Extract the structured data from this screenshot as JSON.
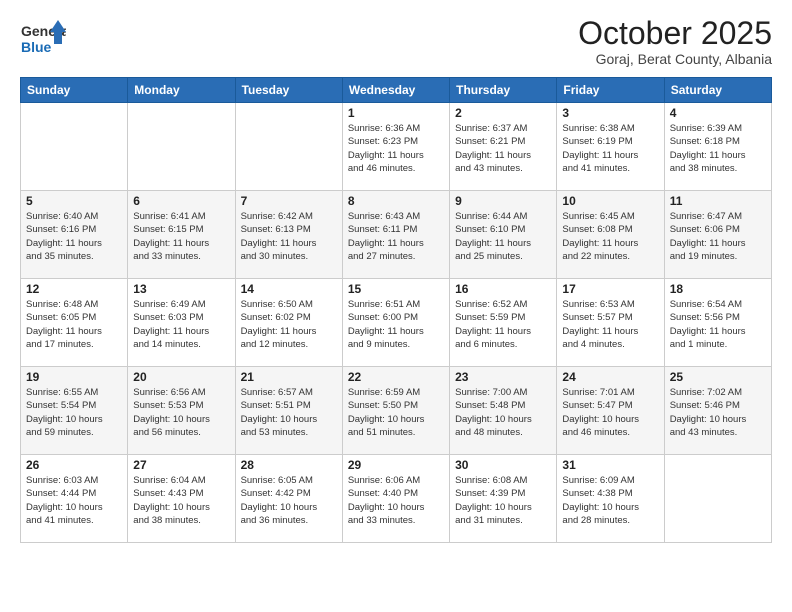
{
  "logo": {
    "general": "General",
    "blue": "Blue"
  },
  "header": {
    "month": "October 2025",
    "location": "Goraj, Berat County, Albania"
  },
  "weekdays": [
    "Sunday",
    "Monday",
    "Tuesday",
    "Wednesday",
    "Thursday",
    "Friday",
    "Saturday"
  ],
  "weeks": [
    [
      {
        "day": "",
        "info": ""
      },
      {
        "day": "",
        "info": ""
      },
      {
        "day": "",
        "info": ""
      },
      {
        "day": "1",
        "info": "Sunrise: 6:36 AM\nSunset: 6:23 PM\nDaylight: 11 hours\nand 46 minutes."
      },
      {
        "day": "2",
        "info": "Sunrise: 6:37 AM\nSunset: 6:21 PM\nDaylight: 11 hours\nand 43 minutes."
      },
      {
        "day": "3",
        "info": "Sunrise: 6:38 AM\nSunset: 6:19 PM\nDaylight: 11 hours\nand 41 minutes."
      },
      {
        "day": "4",
        "info": "Sunrise: 6:39 AM\nSunset: 6:18 PM\nDaylight: 11 hours\nand 38 minutes."
      }
    ],
    [
      {
        "day": "5",
        "info": "Sunrise: 6:40 AM\nSunset: 6:16 PM\nDaylight: 11 hours\nand 35 minutes."
      },
      {
        "day": "6",
        "info": "Sunrise: 6:41 AM\nSunset: 6:15 PM\nDaylight: 11 hours\nand 33 minutes."
      },
      {
        "day": "7",
        "info": "Sunrise: 6:42 AM\nSunset: 6:13 PM\nDaylight: 11 hours\nand 30 minutes."
      },
      {
        "day": "8",
        "info": "Sunrise: 6:43 AM\nSunset: 6:11 PM\nDaylight: 11 hours\nand 27 minutes."
      },
      {
        "day": "9",
        "info": "Sunrise: 6:44 AM\nSunset: 6:10 PM\nDaylight: 11 hours\nand 25 minutes."
      },
      {
        "day": "10",
        "info": "Sunrise: 6:45 AM\nSunset: 6:08 PM\nDaylight: 11 hours\nand 22 minutes."
      },
      {
        "day": "11",
        "info": "Sunrise: 6:47 AM\nSunset: 6:06 PM\nDaylight: 11 hours\nand 19 minutes."
      }
    ],
    [
      {
        "day": "12",
        "info": "Sunrise: 6:48 AM\nSunset: 6:05 PM\nDaylight: 11 hours\nand 17 minutes."
      },
      {
        "day": "13",
        "info": "Sunrise: 6:49 AM\nSunset: 6:03 PM\nDaylight: 11 hours\nand 14 minutes."
      },
      {
        "day": "14",
        "info": "Sunrise: 6:50 AM\nSunset: 6:02 PM\nDaylight: 11 hours\nand 12 minutes."
      },
      {
        "day": "15",
        "info": "Sunrise: 6:51 AM\nSunset: 6:00 PM\nDaylight: 11 hours\nand 9 minutes."
      },
      {
        "day": "16",
        "info": "Sunrise: 6:52 AM\nSunset: 5:59 PM\nDaylight: 11 hours\nand 6 minutes."
      },
      {
        "day": "17",
        "info": "Sunrise: 6:53 AM\nSunset: 5:57 PM\nDaylight: 11 hours\nand 4 minutes."
      },
      {
        "day": "18",
        "info": "Sunrise: 6:54 AM\nSunset: 5:56 PM\nDaylight: 11 hours\nand 1 minute."
      }
    ],
    [
      {
        "day": "19",
        "info": "Sunrise: 6:55 AM\nSunset: 5:54 PM\nDaylight: 10 hours\nand 59 minutes."
      },
      {
        "day": "20",
        "info": "Sunrise: 6:56 AM\nSunset: 5:53 PM\nDaylight: 10 hours\nand 56 minutes."
      },
      {
        "day": "21",
        "info": "Sunrise: 6:57 AM\nSunset: 5:51 PM\nDaylight: 10 hours\nand 53 minutes."
      },
      {
        "day": "22",
        "info": "Sunrise: 6:59 AM\nSunset: 5:50 PM\nDaylight: 10 hours\nand 51 minutes."
      },
      {
        "day": "23",
        "info": "Sunrise: 7:00 AM\nSunset: 5:48 PM\nDaylight: 10 hours\nand 48 minutes."
      },
      {
        "day": "24",
        "info": "Sunrise: 7:01 AM\nSunset: 5:47 PM\nDaylight: 10 hours\nand 46 minutes."
      },
      {
        "day": "25",
        "info": "Sunrise: 7:02 AM\nSunset: 5:46 PM\nDaylight: 10 hours\nand 43 minutes."
      }
    ],
    [
      {
        "day": "26",
        "info": "Sunrise: 6:03 AM\nSunset: 4:44 PM\nDaylight: 10 hours\nand 41 minutes."
      },
      {
        "day": "27",
        "info": "Sunrise: 6:04 AM\nSunset: 4:43 PM\nDaylight: 10 hours\nand 38 minutes."
      },
      {
        "day": "28",
        "info": "Sunrise: 6:05 AM\nSunset: 4:42 PM\nDaylight: 10 hours\nand 36 minutes."
      },
      {
        "day": "29",
        "info": "Sunrise: 6:06 AM\nSunset: 4:40 PM\nDaylight: 10 hours\nand 33 minutes."
      },
      {
        "day": "30",
        "info": "Sunrise: 6:08 AM\nSunset: 4:39 PM\nDaylight: 10 hours\nand 31 minutes."
      },
      {
        "day": "31",
        "info": "Sunrise: 6:09 AM\nSunset: 4:38 PM\nDaylight: 10 hours\nand 28 minutes."
      },
      {
        "day": "",
        "info": ""
      }
    ]
  ]
}
